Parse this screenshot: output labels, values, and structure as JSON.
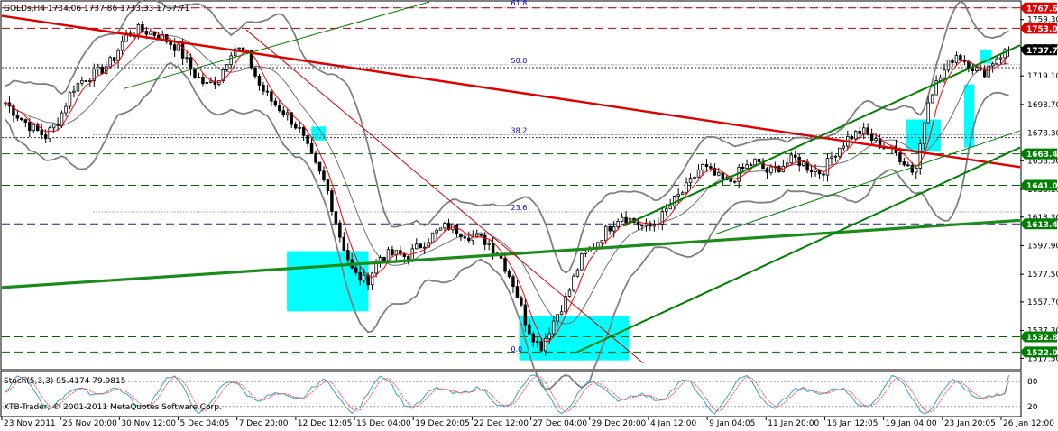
{
  "window": {
    "symbol_info": "GOLDs,H4  1734.06 1737.86 1733.33 1737.71",
    "stoch_info": "Stoch(5,3,3) 95.4174 79.9815",
    "watermark": "XTB-Trader, © 2001-2011 MetaQuotes Software Corp."
  },
  "colors": {
    "background": "#ffffff",
    "candle": "#000000",
    "ma": "#ff0000",
    "bollinger": "#808080",
    "trend_red": "#e00000",
    "trend_green": "#008000",
    "channel_green": "#1a8c1a",
    "highlight": "#00ffff",
    "stoch_main": "#3aa0c8",
    "stoch_signal": "#ff5050",
    "fib_label": "#0000c8",
    "price_label_red_bg": "#e00000",
    "price_label_green_bg": "#008000",
    "price_label_black_bg": "#000000"
  },
  "chart_data": {
    "type": "candlestick",
    "symbol": "GOLDs",
    "timeframe": "H4",
    "ohlc_current": {
      "open": 1734.06,
      "high": 1737.86,
      "low": 1733.33,
      "close": 1737.71
    },
    "ylim": [
      1510.0,
      1772.0
    ],
    "y_ticks": [
      1759.3,
      1739.5,
      1719.1,
      1698.7,
      1678.3,
      1658.5,
      1638.1,
      1618.3,
      1597.9,
      1577.5,
      1557.7,
      1537.3,
      1517.5
    ],
    "x_labels": [
      "23 Nov 2011",
      "25 Nov 20:00",
      "30 Nov 12:00",
      "5 Dec 04:05",
      "7 Dec 20:00",
      "12 Dec 12:05",
      "15 Dec 04:00",
      "19 Dec 20:05",
      "22 Dec 12:00",
      "27 Dec 04:00",
      "29 Dec 20:00",
      "4 Jan 12:00",
      "9 Jan 04:05",
      "11 Jan 20:00",
      "16 Jan 12:05",
      "19 Jan 04:00",
      "23 Jan 20:05",
      "26 Jan 12:00"
    ],
    "close_path": [
      1700,
      1690,
      1682,
      1676,
      1688,
      1710,
      1718,
      1722,
      1730,
      1748,
      1752,
      1750,
      1745,
      1738,
      1722,
      1712,
      1718,
      1740,
      1735,
      1712,
      1700,
      1692,
      1680,
      1658,
      1640,
      1605,
      1578,
      1572,
      1590,
      1592,
      1590,
      1598,
      1606,
      1612,
      1608,
      1604,
      1601,
      1590,
      1570,
      1540,
      1525,
      1545,
      1562,
      1588,
      1598,
      1610,
      1620,
      1615,
      1610,
      1618,
      1630,
      1640,
      1655,
      1648,
      1642,
      1652,
      1658,
      1650,
      1655,
      1660,
      1654,
      1650,
      1665,
      1675,
      1680,
      1672,
      1668,
      1660,
      1650,
      1705,
      1720,
      1735,
      1728,
      1720,
      1732,
      1737.71
    ],
    "price_labels": [
      {
        "value": "1767.65",
        "kind": "red"
      },
      {
        "value": "1753.07",
        "kind": "red"
      },
      {
        "value": "1737.71",
        "kind": "black"
      },
      {
        "value": "1663.42",
        "kind": "green"
      },
      {
        "value": "1641.00",
        "kind": "green"
      },
      {
        "value": "1613.46",
        "kind": "green"
      },
      {
        "value": "1532.89",
        "kind": "green"
      },
      {
        "value": "1522.00",
        "kind": "green"
      }
    ],
    "horizontal_levels": [
      {
        "value": 1767.65,
        "kind": "red"
      },
      {
        "value": 1753.07,
        "kind": "red"
      },
      {
        "value": 1663.42,
        "kind": "green"
      },
      {
        "value": 1641.0,
        "kind": "green"
      },
      {
        "value": 1613.46,
        "kind": "blue"
      },
      {
        "value": 1532.89,
        "kind": "green"
      },
      {
        "value": 1522.0,
        "kind": "green"
      },
      {
        "value": 1675.0,
        "kind": "dotted"
      },
      {
        "value": 1725.0,
        "kind": "dotted"
      }
    ],
    "fib_levels": [
      {
        "label": "61.8",
        "value": 1768.0
      },
      {
        "label": "50.0",
        "value": 1727.0
      },
      {
        "label": "38.2",
        "value": 1677.0
      },
      {
        "label": "23.6",
        "value": 1622.0
      },
      {
        "label": "0.0",
        "value": 1521.0
      }
    ],
    "stochastic": {
      "params": "5,3,3",
      "main": 95.4174,
      "signal": 79.9815,
      "levels": [
        80,
        20
      ],
      "ylim": [
        0,
        100
      ],
      "tick_labels": [
        "80",
        "20"
      ]
    }
  }
}
